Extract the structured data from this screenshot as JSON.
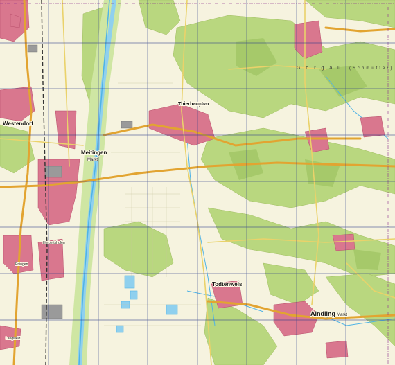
{
  "colors": {
    "background": "#f6f3df",
    "forest": "#b9d77f",
    "forest_dark": "#a6c96a",
    "urban": "#d9778e",
    "urban_dark": "#b84d6a",
    "water": "#8fd0ee",
    "river": "#4fb3e6",
    "road_major": "#e2a431",
    "road_minor": "#ead26a",
    "grid": "#2c3c8a",
    "border": "#8a2f8c",
    "railway": "#333333"
  },
  "places": {
    "westendorf": "Westendorf",
    "meitingen": "Meitingen",
    "meitingen_sub": "Markt",
    "thierhaupten": "Thierhaupten",
    "thierhaupten_sub": "Markt",
    "todtenweis": "Todtenweis",
    "aindling": "Aindling",
    "aindling_sub": "Markt",
    "erlingen": "Erlingen",
    "herbertshofen": "Herbertshofen",
    "langweid": "Langweid"
  },
  "regions": {
    "schmutter_left": "G ö r g a u",
    "schmutter_right": "(Schmutter)"
  }
}
